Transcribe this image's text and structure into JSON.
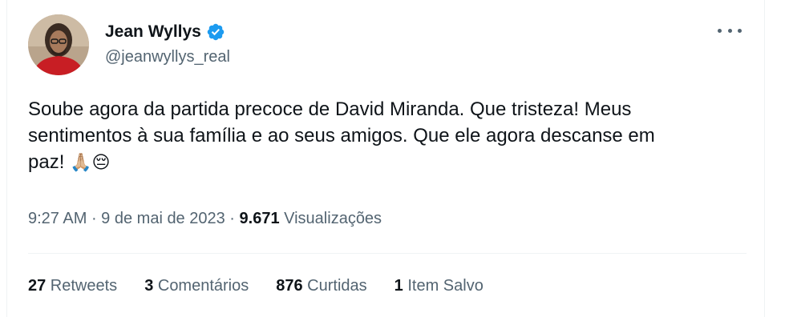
{
  "author": {
    "name": "Jean Wyllys",
    "handle": "@jeanwyllys_real",
    "verified_icon": "verified-badge-icon",
    "avatar_icon": "avatar"
  },
  "tweet": {
    "lines": [
      "Soube agora da partida precoce de David Miranda. Que tristeza! Meus",
      "sentimentos à sua família e ao seus amigos. Que ele agora descanse em",
      "paz!"
    ],
    "emojis": "🙏🏼😔"
  },
  "meta": {
    "time": "9:27 AM",
    "sep1": " · ",
    "date": "9 de mai de 2023",
    "sep2": " · ",
    "views_count": "9.671",
    "views_label": " Visualizações"
  },
  "stats": [
    {
      "count": "27",
      "label": " Retweets"
    },
    {
      "count": "3",
      "label": " Comentários"
    },
    {
      "count": "876",
      "label": " Curtidas"
    },
    {
      "count": "1",
      "label": " Item Salvo"
    }
  ],
  "colors": {
    "accent": "#1d9bf0",
    "secondary_text": "#536471",
    "primary_text": "#0f1419"
  }
}
